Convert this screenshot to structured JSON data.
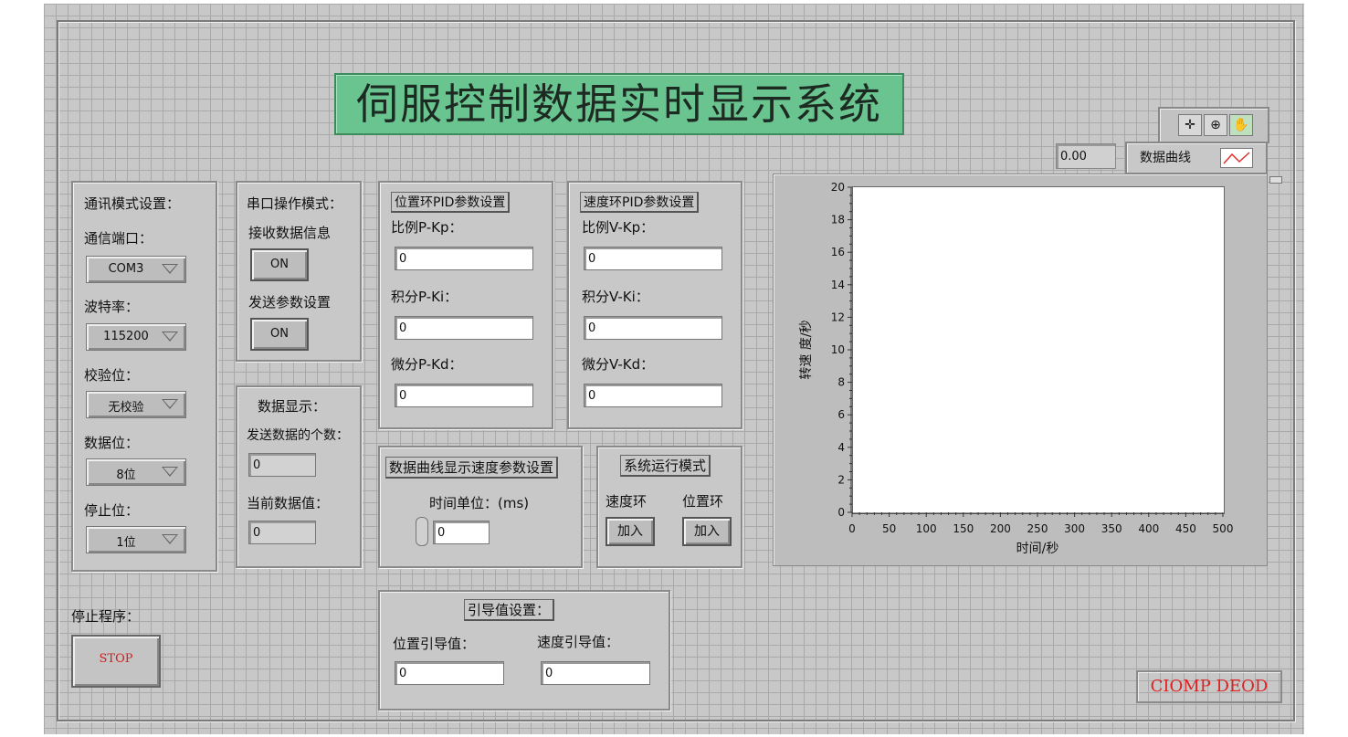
{
  "title": "伺服控制数据实时显示系统",
  "comm": {
    "heading": "通讯模式设置：",
    "port_label": "通信端口：",
    "port_value": "COM3",
    "baud_label": "波特率：",
    "baud_value": "115200",
    "parity_label": "校验位：",
    "parity_value": "无校验",
    "databits_label": "数据位：",
    "databits_value": "8位",
    "stopbits_label": "停止位：",
    "stopbits_value": "1位"
  },
  "serial": {
    "heading": "串口操作模式：",
    "receive_label": "接收数据信息",
    "receive_button": "ON",
    "send_label": "发送参数设置",
    "send_button": "ON"
  },
  "display": {
    "heading": "数据显示：",
    "count_label": "发送数据的个数：",
    "count_value": "0",
    "current_label": "当前数据值：",
    "current_value": "0"
  },
  "pos_pid": {
    "heading": "位置环PID参数设置",
    "kp_label": "比例P-Kp：",
    "kp_value": "0",
    "ki_label": "积分P-Ki：",
    "ki_value": "0",
    "kd_label": "微分P-Kd：",
    "kd_value": "0"
  },
  "vel_pid": {
    "heading": "速度环PID参数设置",
    "kp_label": "比例V-Kp：",
    "kp_value": "0",
    "ki_label": "积分V-Ki：",
    "ki_value": "0",
    "kd_label": "微分V-Kd：",
    "kd_value": "0"
  },
  "curve_speed": {
    "heading": "数据曲线显示速度参数设置",
    "unit_label": "时间单位：(ms)",
    "unit_value": "0"
  },
  "run_mode": {
    "heading": "系统运行模式",
    "vel_label": "速度环",
    "pos_label": "位置环",
    "vel_button": "加入",
    "pos_button": "加入"
  },
  "stop": {
    "label": "停止程序：",
    "button": "STOP"
  },
  "ref": {
    "heading": "引导值设置：",
    "pos_label": "位置引导值：",
    "pos_value": "0",
    "vel_label": "速度引导值：",
    "vel_value": "0"
  },
  "graph": {
    "cursor_value": "0.00",
    "legend_label": "数据曲线"
  },
  "brand": "CIOMP DEOD",
  "chart_data": {
    "type": "line",
    "title": "",
    "xlabel": "时间/秒",
    "ylabel": "转速 度/秒",
    "xlim": [
      0,
      500
    ],
    "ylim": [
      0,
      20
    ],
    "x_ticks": [
      0,
      50,
      100,
      150,
      200,
      250,
      300,
      350,
      400,
      450,
      500
    ],
    "y_ticks": [
      0,
      2,
      4,
      6,
      8,
      10,
      12,
      14,
      16,
      18,
      20
    ],
    "series": [
      {
        "name": "数据曲线",
        "x": [],
        "y": []
      }
    ],
    "grid": false
  }
}
